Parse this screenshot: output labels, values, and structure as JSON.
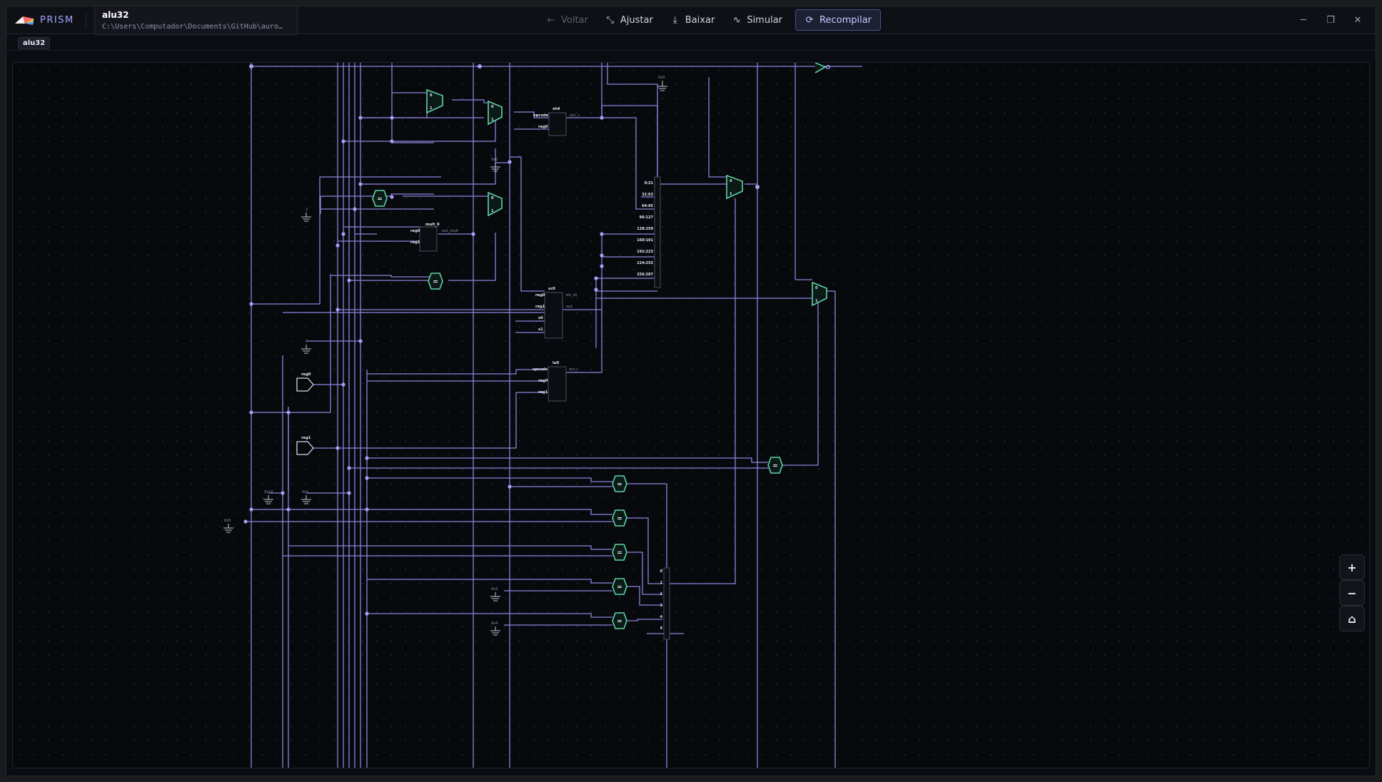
{
  "app": {
    "name": "PRISM"
  },
  "file": {
    "name": "alu32",
    "path": "C:\\Users\\Computador\\Documents\\GitHub\\auro…"
  },
  "toolbar": {
    "back": "Voltar",
    "fit": "Ajustar",
    "download": "Baixar",
    "simulate": "Simular",
    "recompile": "Recompilar"
  },
  "breadcrumb": {
    "current": "alu32"
  },
  "zoom": {
    "in": "+",
    "out": "−",
    "home": "⌂"
  },
  "circuit": {
    "inputs": {
      "reg0": "reg0",
      "reg1": "reg1"
    },
    "constants": {
      "c1": "0x0",
      "c2": "0x0",
      "c3": "2",
      "c4": "3",
      "c5": "0x16",
      "c6": "0x1",
      "c7": "0x5",
      "c8": "0x3",
      "c9": "0x4"
    },
    "mux_labels": {
      "zero": "0",
      "one": "1"
    },
    "eq_symbol": "=",
    "sh4": {
      "name": "sh4",
      "in1": "opcode",
      "in2": "reg0",
      "out": "out_s"
    },
    "mult": {
      "name": "mult_0",
      "in1": "reg0",
      "in2": "reg1",
      "out": "out_mult"
    },
    "slt": {
      "name": "sc0",
      "in1": "reg0",
      "in2": "reg1",
      "in3": "s0",
      "in4": "s1",
      "out1": "bit_s0",
      "out2": "out"
    },
    "lu": {
      "name": "lu0",
      "in1": "opcode",
      "in2": "reg0",
      "in3": "reg1",
      "out": "out_l"
    },
    "splitter": [
      "0:31",
      "32:63",
      "64:95",
      "96:127",
      "128:159",
      "160:191",
      "192:223",
      "224:255",
      "256:287"
    ],
    "selector": [
      "0",
      "1",
      "2",
      "3",
      "4",
      "5"
    ]
  },
  "colors": {
    "wire": "#8b84dc",
    "component": "#5fd3a5",
    "accent": "#9fa6ff"
  }
}
